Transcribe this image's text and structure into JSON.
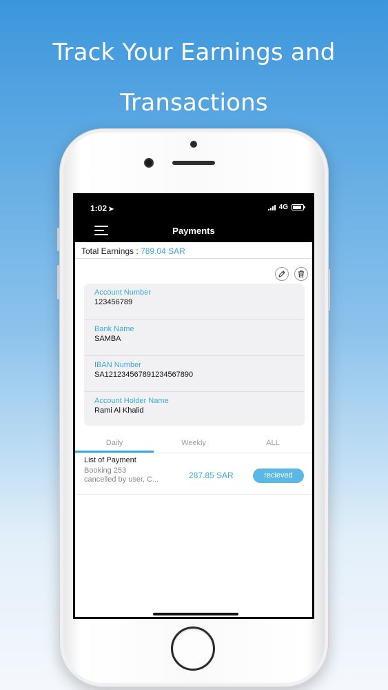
{
  "headline": {
    "line1": "Track Your Earnings and",
    "line2": "Transactions"
  },
  "status_bar": {
    "time": "1:02",
    "location_glyph": "➤",
    "network": "4G"
  },
  "nav": {
    "title": "Payments",
    "menu_icon": "hamburger-icon"
  },
  "earnings": {
    "label": "Total Earnings :",
    "value": "789.04 SAR"
  },
  "actions": {
    "edit_icon": "pencil-icon",
    "delete_icon": "trash-icon"
  },
  "bank_details": [
    {
      "label": "Account Number",
      "value": "123456789"
    },
    {
      "label": "Bank Name",
      "value": "SAMBA"
    },
    {
      "label": "IBAN Number",
      "value": "SA121234567891234567890"
    },
    {
      "label": "Account Holder Name",
      "value": "Rami Al Khalid"
    }
  ],
  "tabs": [
    {
      "label": "Daily",
      "selected": true
    },
    {
      "label": "Weekly",
      "selected": false
    },
    {
      "label": "ALL",
      "selected": false
    }
  ],
  "payments": {
    "title": "List of Payment",
    "items": [
      {
        "desc_line1": "Booking 253",
        "desc_line2": "cancelled by user, C...",
        "amount": "287.85 SAR",
        "status": "recieved"
      }
    ]
  },
  "colors": {
    "accent": "#3ba9dc",
    "badge": "#5bb8e4",
    "bar": "#000000"
  }
}
